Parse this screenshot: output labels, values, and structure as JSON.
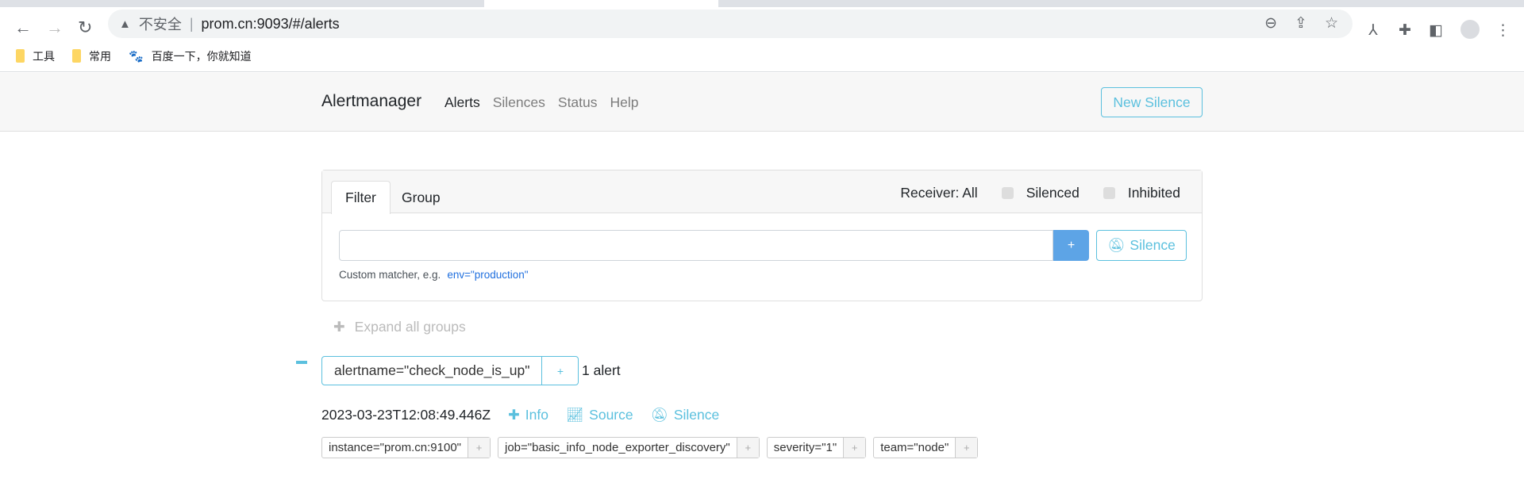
{
  "browser": {
    "security_label": "不安全",
    "url": "prom.cn:9093/#/alerts",
    "bookmarks": [
      {
        "label": "工具",
        "icon": "folder-icon"
      },
      {
        "label": "常用",
        "icon": "folder-icon"
      },
      {
        "label": "百度一下，你就知道",
        "icon": "baidu-paw-icon"
      }
    ]
  },
  "navbar": {
    "brand": "Alertmanager",
    "links": [
      "Alerts",
      "Silences",
      "Status",
      "Help"
    ],
    "active": "Alerts",
    "new_silence": "New Silence"
  },
  "filter": {
    "tabs": [
      "Filter",
      "Group"
    ],
    "receiver": "Receiver: All",
    "silenced": "Silenced",
    "inhibited": "Inhibited",
    "input_value": "",
    "add_label": "+",
    "silence_label": "Silence",
    "helper": "Custom matcher, e.g.",
    "example": "env=\"production\""
  },
  "expand_all": "Expand all groups",
  "group": {
    "label": "alertname=\"check_node_is_up\"",
    "plus": "+",
    "count": "1 alert",
    "alert": {
      "timestamp": "2023-03-23T12:08:49.446Z",
      "info": "Info",
      "source": "Source",
      "silence": "Silence",
      "labels": [
        "instance=\"prom.cn:9100\"",
        "job=\"basic_info_node_exporter_discovery\"",
        "severity=\"1\"",
        "team=\"node\""
      ]
    }
  },
  "colors": {
    "accent": "#5bc0de",
    "primary": "#5da4e6",
    "link": "#1f6fde"
  }
}
